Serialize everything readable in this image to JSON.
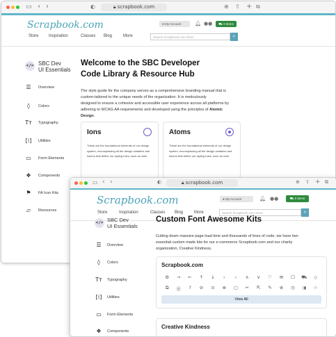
{
  "browser": {
    "url": "scrapbook.com"
  },
  "site": {
    "logo": "Scrapbook.com",
    "nav": [
      "Store",
      "Inspiration",
      "Classes",
      "Blog",
      "More"
    ],
    "account_label": "My Account",
    "cart_label": "0 items",
    "search_placeholder": "Search Scrapbook.com Store"
  },
  "sidebar": {
    "brand_line1": "SBC Dev",
    "brand_line2": "UI Essentials",
    "items": [
      {
        "label": "Overview",
        "icon": "list-icon"
      },
      {
        "label": "Colors",
        "icon": "droplet-icon"
      },
      {
        "label": "Typography",
        "icon": "text-icon"
      },
      {
        "label": "Utilities",
        "icon": "brackets-icon"
      },
      {
        "label": "Form Elements",
        "icon": "form-icon"
      },
      {
        "label": "Components",
        "icon": "components-icon"
      },
      {
        "label": "FA Icon Kits",
        "icon": "font-awesome-icon"
      },
      {
        "label": "Resources",
        "icon": "folder-icon"
      }
    ]
  },
  "page1": {
    "title_line1": "Welcome to the SBC Developer",
    "title_line2": "Code Library & Resource Hub",
    "intro": [
      "The style guide for the company serves as a comprehensive branding manual that is",
      "custom-tailored to the unique needs of the organization. It is meticulously",
      "designed to ensure a cohesive and accessible user experience across all platforms by",
      "adhering to WCAG AA requirements and developed using the principles of"
    ],
    "intro_bold": "Atomic",
    "intro_bold2": "Design",
    "intro_end": ".",
    "cards": [
      {
        "title": "Ions",
        "text": [
          "These are the foundational elements of our design",
          "system, encompassing all the design variables and",
          "tokens that define our styling rules, such as color"
        ]
      },
      {
        "title": "Atoms",
        "text": [
          "These are the foundational elements of our design",
          "system, encompassing all the design variables and",
          "tokens that define our styling rules, such as color"
        ]
      }
    ]
  },
  "page2": {
    "title": "Custom Font Awesome Kits",
    "intro": [
      "Cutting down massive page load time and thousands of lines of code, we have two",
      "essential custom made kits for our e-commerce Scrapbook.com and our charity",
      "organization, Creative Kindness."
    ],
    "kit1_title": "Scrapbook.com",
    "kit1_icons_row1": [
      "⚙",
      "→",
      "←",
      "↑",
      "↓",
      "›",
      "‹",
      "∧",
      "∨",
      "♡",
      "✉",
      "☐",
      "⛟",
      "◇"
    ],
    "kit1_icons_row2": [
      "⧉",
      "⓪",
      "?",
      "⊘",
      "⊙",
      "⊗",
      "▢",
      "✂",
      "⇱",
      "✎",
      "⊕",
      "◷",
      "◑",
      "☆"
    ],
    "view_all": "View All",
    "kit2_title": "Creative Kindness"
  }
}
